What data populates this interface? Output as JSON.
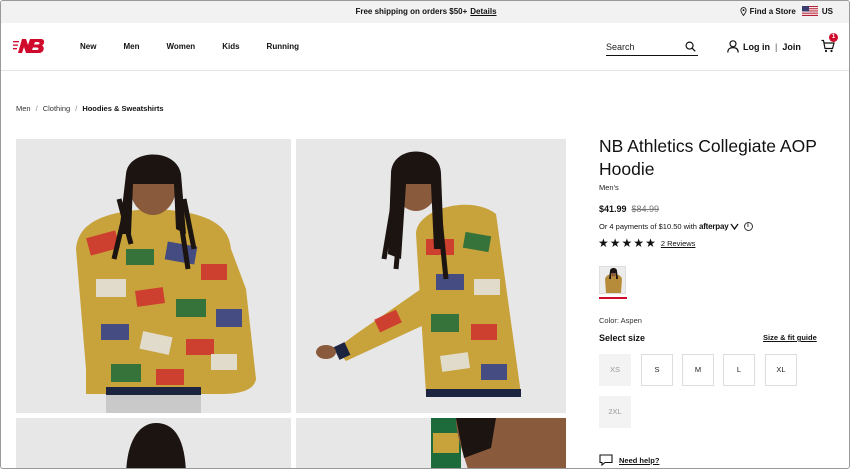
{
  "promo": {
    "text": "Free shipping on orders $50+",
    "link": "Details"
  },
  "topbar": {
    "find_store": "Find a Store",
    "locale": "US"
  },
  "nav": [
    "New",
    "Men",
    "Women",
    "Kids",
    "Running"
  ],
  "search": {
    "placeholder": "Search"
  },
  "account": {
    "login": "Log in",
    "separator": "|",
    "join": "Join"
  },
  "cart": {
    "count": "1"
  },
  "breadcrumb": {
    "items": [
      "Men",
      "Clothing",
      "Hoodies & Sweatshirts"
    ],
    "separator": "/"
  },
  "product": {
    "title": "NB Athletics Collegiate AOP Hoodie",
    "gender": "Men's",
    "price": "$41.99",
    "original_price": "$84.99",
    "afterpay_text": "Or 4 payments of $10.50 with",
    "afterpay_logo": "afterpay",
    "info_icon": "i",
    "rating_stars": 5,
    "reviews": "2 Reviews",
    "color_label": "Color: Aspen",
    "size_label": "Select size",
    "size_guide": "Size & fit guide",
    "sizes": [
      {
        "label": "XS",
        "available": false
      },
      {
        "label": "S",
        "available": true
      },
      {
        "label": "M",
        "available": true
      },
      {
        "label": "L",
        "available": true
      },
      {
        "label": "XL",
        "available": true
      },
      {
        "label": "2XL",
        "available": false
      }
    ],
    "help": "Need help?"
  },
  "colors": {
    "brand_red": "#cf0a2c",
    "promo_bg": "#f2f2f2",
    "image_bg": "#e7e7e7"
  },
  "icons": [
    "location-pin-icon",
    "us-flag-icon",
    "nb-logo",
    "search-icon",
    "user-icon",
    "cart-icon",
    "star-icon",
    "info-icon",
    "chat-icon"
  ]
}
